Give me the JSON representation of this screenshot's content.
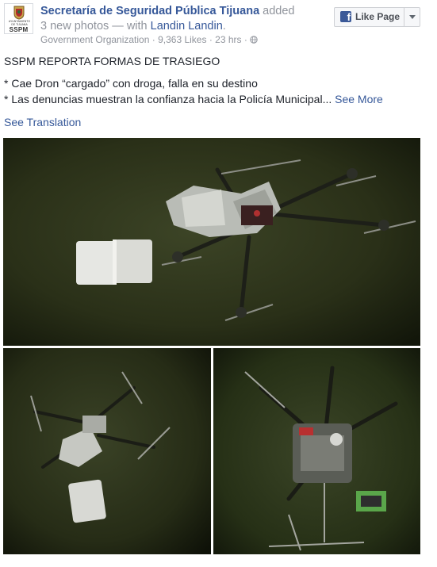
{
  "header": {
    "page_name": "Secretaría de Seguridad Pública Tijuana",
    "action_text": "added 3 new photos — with",
    "tagged_user": "Landin Landin",
    "tagged_suffix": ".",
    "category": "Government Organization",
    "likes": "9,363 Likes",
    "time": "23 hrs",
    "separator": "·",
    "privacy_icon": "globe-icon"
  },
  "avatar": {
    "label": "SSPM",
    "small_text": "AYUNTAMIENTO DE TIJUANA"
  },
  "like_page": {
    "label": "Like Page",
    "icon": "facebook-f-icon",
    "dropdown_icon": "caret-down-icon"
  },
  "post": {
    "title": "SSPM REPORTA FORMAS DE TRASIEGO",
    "line1": "* Cae Dron “cargado” con droga, falla en su destino",
    "line2": "* Las denuncias muestran la confianza hacia la Policía Municipal...",
    "see_more": "See More",
    "see_translation": "See Translation"
  },
  "photos": [
    {
      "name": "photo-drone-main"
    },
    {
      "name": "photo-drone-left"
    },
    {
      "name": "photo-drone-right"
    }
  ],
  "colors": {
    "link": "#365899",
    "text": "#1d2129",
    "meta": "#90949c",
    "facebook_blue": "#3b5998"
  }
}
